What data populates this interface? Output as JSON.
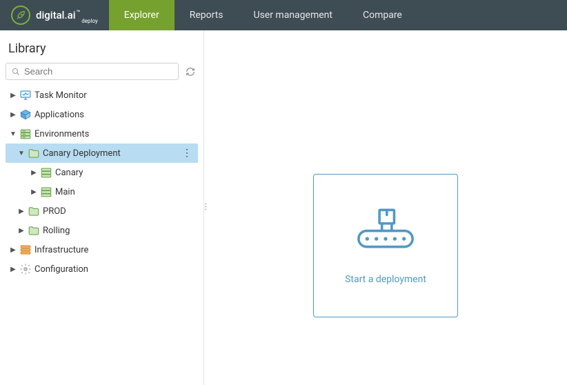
{
  "brand": {
    "name": "digital.ai",
    "sub": "deploy"
  },
  "nav": {
    "items": [
      {
        "label": "Explorer",
        "active": true
      },
      {
        "label": "Reports",
        "active": false
      },
      {
        "label": "User management",
        "active": false
      },
      {
        "label": "Compare",
        "active": false
      }
    ]
  },
  "sidebar": {
    "title": "Library",
    "search_placeholder": "Search",
    "tree": {
      "task_monitor": "Task Monitor",
      "applications": "Applications",
      "environments": "Environments",
      "canary_deployment": "Canary Deployment",
      "canary": "Canary",
      "main_env": "Main",
      "prod": "PROD",
      "rolling": "Rolling",
      "infrastructure": "Infrastructure",
      "configuration": "Configuration"
    }
  },
  "content": {
    "start_deployment": "Start a deployment"
  },
  "colors": {
    "brand_green": "#76a12e",
    "accent_blue": "#4f99c6",
    "topbar_bg": "#3e4c54",
    "selected_bg": "#b8dcf2"
  }
}
